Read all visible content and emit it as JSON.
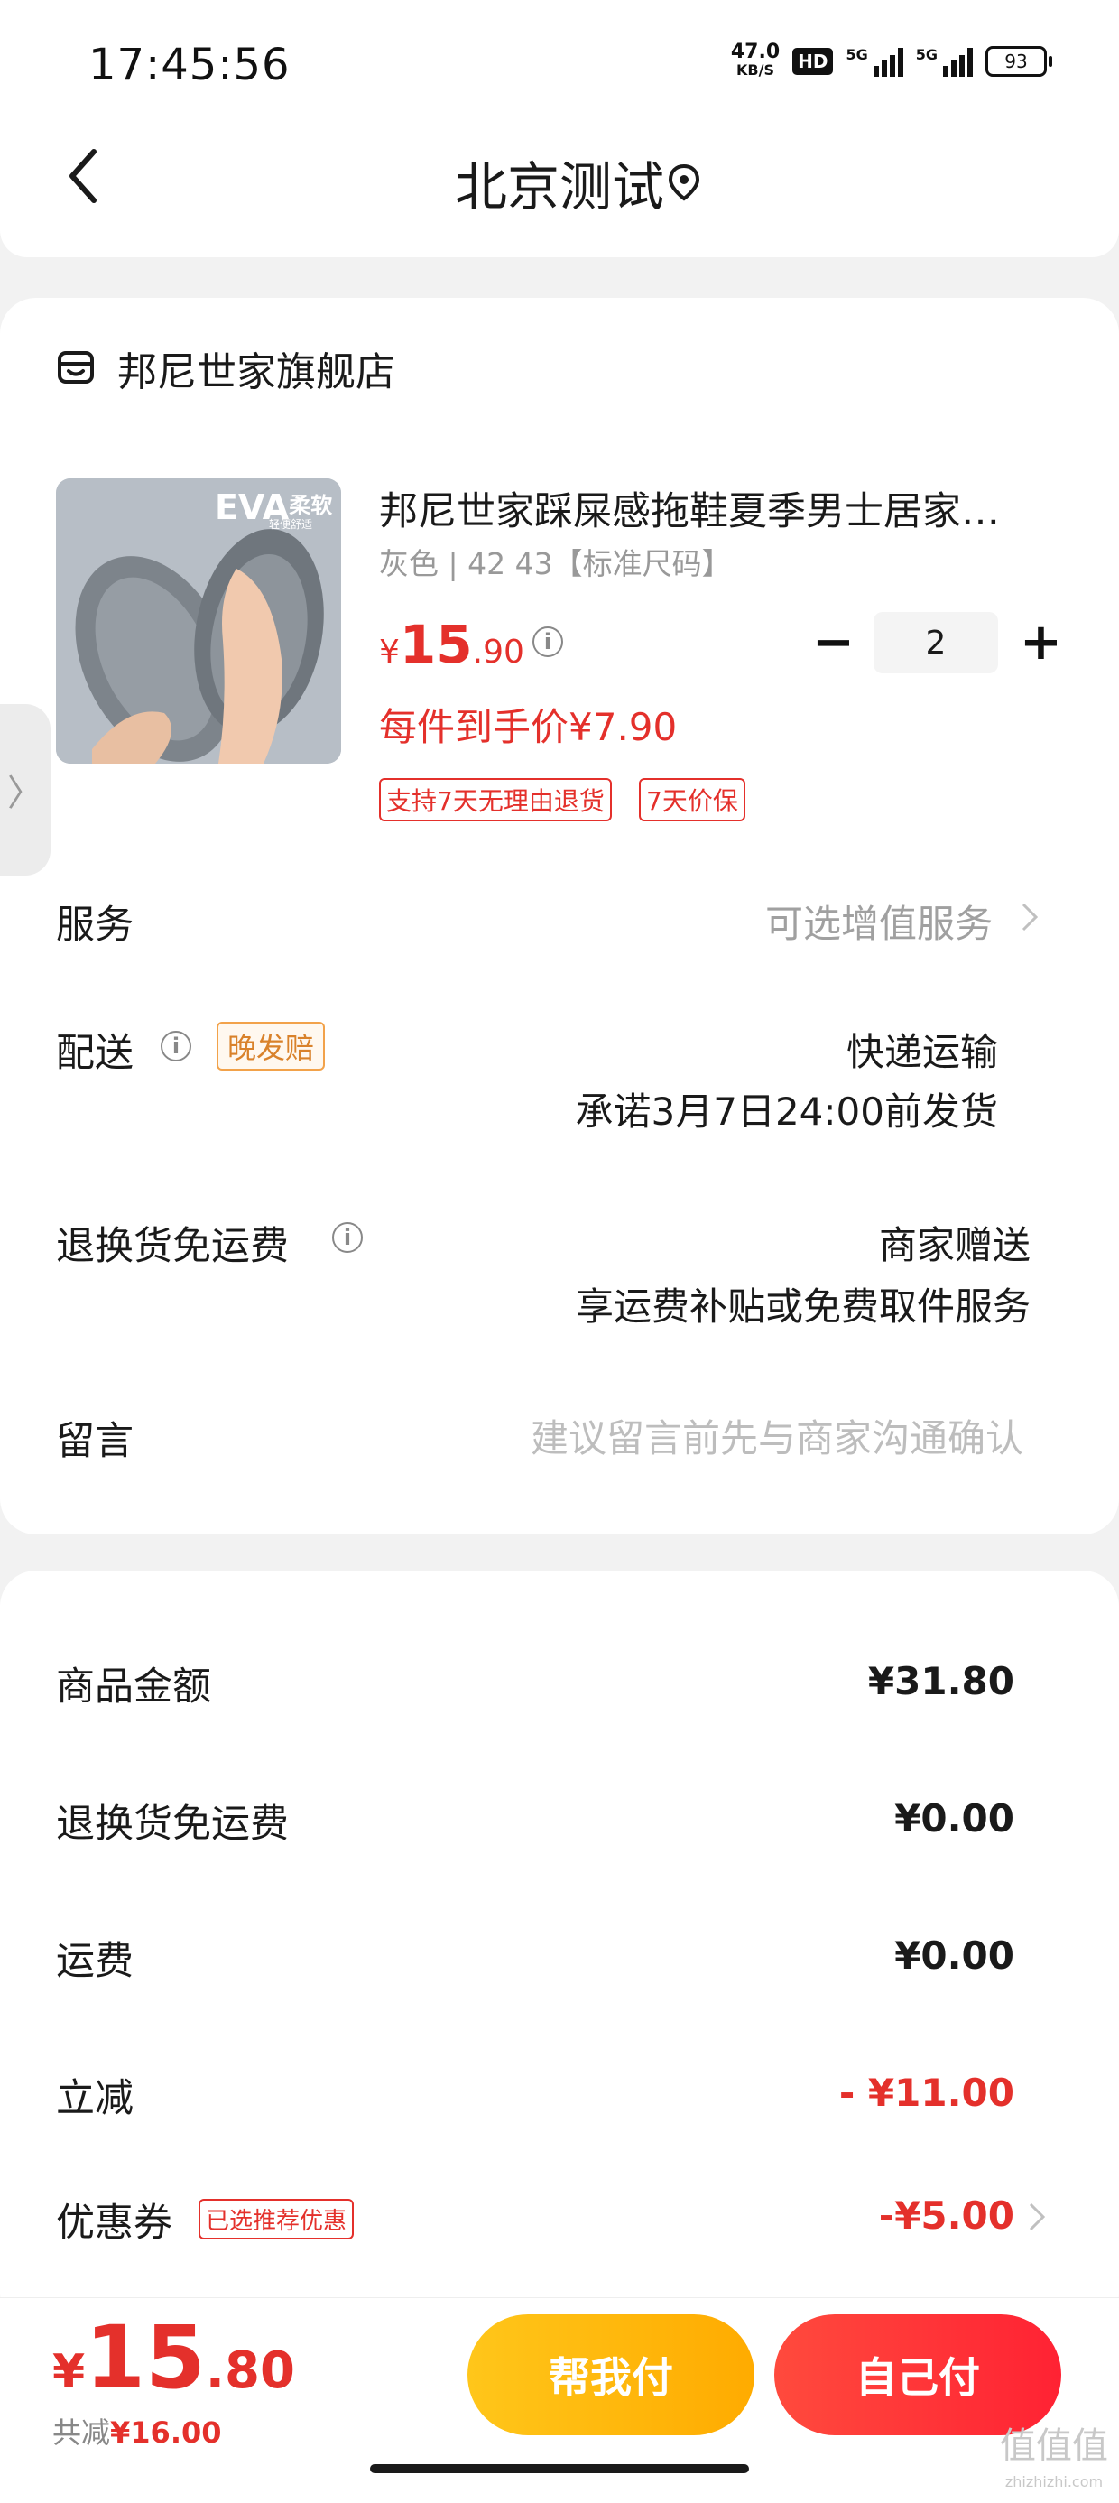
{
  "status_bar": {
    "time": "17:45:56",
    "net_speed": "47.0",
    "net_unit": "KB/S",
    "hd_badge": "HD",
    "signal1_label": "5G",
    "signal2_label": "5G",
    "battery": "93"
  },
  "nav": {
    "title": "北京测试"
  },
  "store": {
    "name": "邦尼世家旗舰店"
  },
  "product": {
    "title": "邦尼世家踩屎感拖鞋夏季男士居家…",
    "spec": "灰色 | 42 43【标准尺码】",
    "image_badge_main": "EVA",
    "image_badge_sub": "柔软",
    "image_badge_small": "轻便舒适",
    "price_currency": "¥",
    "price_int": "15",
    "price_dec": ".90",
    "quantity": "2",
    "minus_label": "−",
    "plus_label": "+",
    "each_price": "每件到手价¥7.90",
    "tags": [
      "支持7天无理由退货",
      "7天价保"
    ]
  },
  "side_tab": {
    "glyph": "〉"
  },
  "rows": {
    "service_label": "服务",
    "service_value": "可选增值服务",
    "delivery_label": "配送",
    "delivery_tag": "晚发赔",
    "delivery_value1": "快递运输",
    "delivery_value2": "承诺3月7日24:00前发货",
    "return_label": "退换货免运费",
    "return_value1": "商家赠送",
    "return_value2": "享运费补贴或免费取件服务",
    "message_label": "留言",
    "message_placeholder": "建议留言前先与商家沟通确认"
  },
  "summary": {
    "goods_label": "商品金额",
    "goods_value": "¥31.80",
    "return_label": "退换货免运费",
    "return_value": "¥0.00",
    "shipping_label": "运费",
    "shipping_value": "¥0.00",
    "discount_label": "立减",
    "discount_value": "- ¥11.00",
    "coupon_label": "优惠券",
    "coupon_tag": "已选推荐优惠",
    "coupon_value": "-¥5.00"
  },
  "footer": {
    "total_currency": "¥",
    "total_int": "15",
    "total_dec": ".80",
    "saved_prefix": "共减",
    "saved_value": "¥16.00",
    "help_pay": "帮我付",
    "self_pay": "自己付"
  },
  "watermark": {
    "text": "值值值",
    "site": "zhizhizhi.com"
  },
  "colors": {
    "accent_red": "#e4302b",
    "help_button": "#ffb800",
    "self_button": "#ff2f36",
    "late_tag": "#d9822b"
  }
}
